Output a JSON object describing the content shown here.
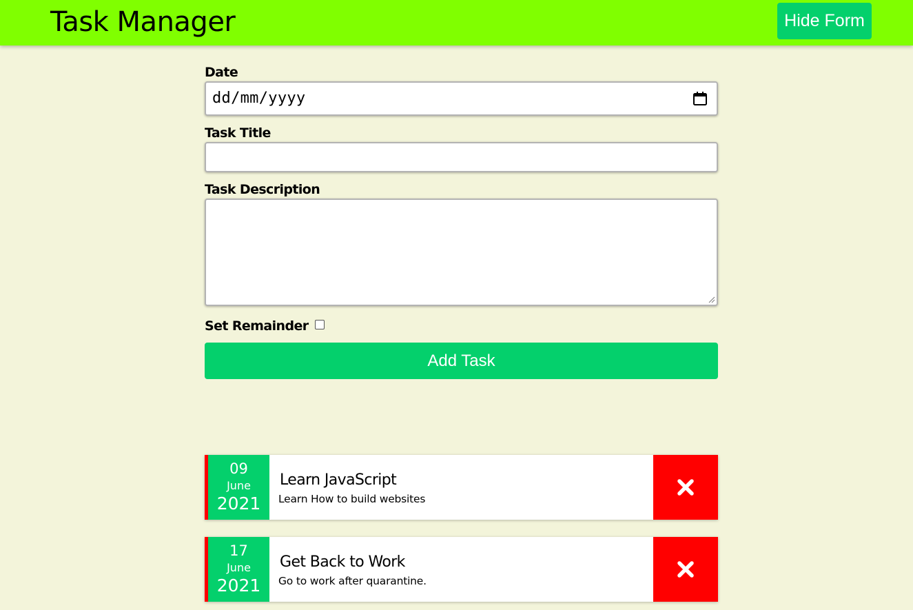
{
  "header": {
    "title": "Task Manager",
    "toggle_label": "Hide Form"
  },
  "form": {
    "date_label": "Date",
    "date_placeholder": "dd/mm/yyyy",
    "title_label": "Task Title",
    "title_value": "",
    "description_label": "Task Description",
    "description_value": "",
    "reminder_label": "Set Remainder",
    "reminder_checked": false,
    "submit_label": "Add Task"
  },
  "tasks": [
    {
      "day": "09",
      "month": "June",
      "year": "2021",
      "title": "Learn JavaScript",
      "description": "Learn How to build websites"
    },
    {
      "day": "17",
      "month": "June",
      "year": "2021",
      "title": "Get Back to Work",
      "description": "Go to work after quarantine."
    }
  ],
  "colors": {
    "header_bg": "#80ff00",
    "accent_green": "#04d06c",
    "delete_red": "#ff0000",
    "page_bg": "#f3f4da"
  },
  "icons": {
    "date_picker": "calendar-icon",
    "delete": "close-icon"
  }
}
